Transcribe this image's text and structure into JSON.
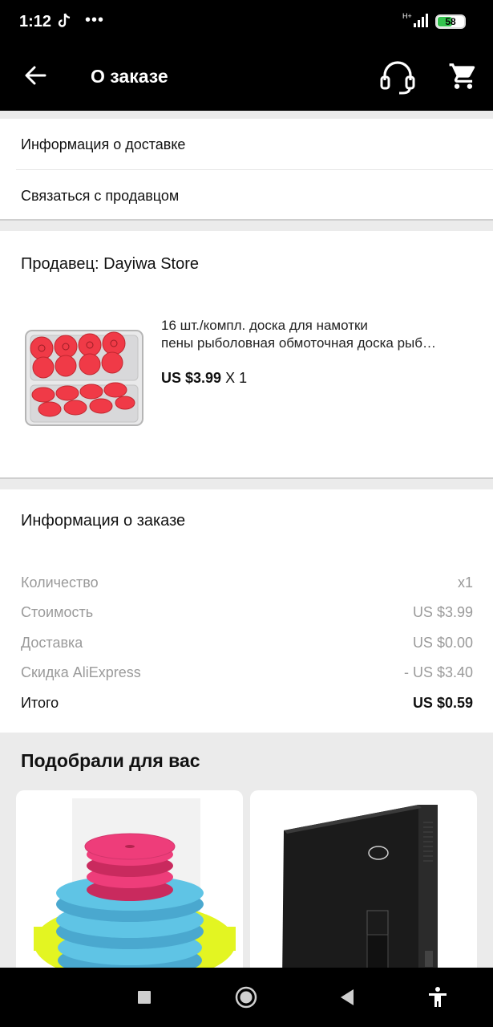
{
  "status_bar": {
    "time": "1:12",
    "dots": "•••",
    "network": "H+",
    "battery": "58",
    "battery_level": 0.58
  },
  "app_bar": {
    "title": "О заказе"
  },
  "links": {
    "delivery_info": "Информация о доставке",
    "contact_seller": "Связаться с продавцом"
  },
  "seller": {
    "name": "Продавец: Dayiwa Store",
    "product": {
      "title_line1": "16 шт./компл. доска для намотки",
      "title_line2": "пены рыболовная обмоточная доска рыб…",
      "price": "US $3.99",
      "quantity": "X 1"
    }
  },
  "order_info": {
    "title": "Информация о заказе",
    "rows": [
      {
        "label": "Количество",
        "value": "x1"
      },
      {
        "label": "Стоимость",
        "value": "US $3.99"
      },
      {
        "label": "Доставка",
        "value": "US $0.00"
      },
      {
        "label": "Скидка AliExpress",
        "value": "- US $3.40"
      },
      {
        "label": "Итого",
        "value": "US $0.59"
      }
    ]
  },
  "recommendations": {
    "title": "Подобрали для вас"
  },
  "colors": {
    "app_bar": "#000000",
    "battery": "#33c24d",
    "product_red": "#f03a47",
    "reco_pink": "#ee3d7a",
    "reco_blue": "#5fc4e5",
    "reco_yellow": "#e3f522"
  }
}
